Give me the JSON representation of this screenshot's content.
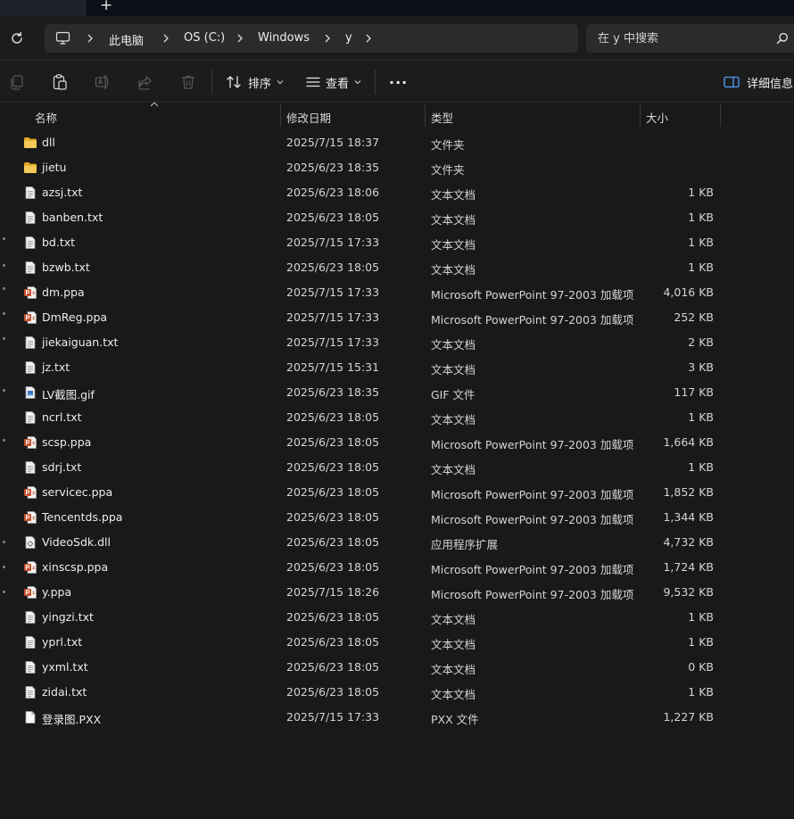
{
  "tabs": {
    "new_tab_label": "+"
  },
  "breadcrumb": [
    {
      "label": "此电脑"
    },
    {
      "label": "OS (C:)"
    },
    {
      "label": "Windows"
    },
    {
      "label": "y"
    }
  ],
  "search": {
    "placeholder": "在 y 中搜索"
  },
  "toolbar": {
    "sort_label": "排序",
    "view_label": "查看",
    "more_label": "···",
    "details_label": "详细信息"
  },
  "columns": {
    "name": "名称",
    "date": "修改日期",
    "type": "类型",
    "size": "大小"
  },
  "colors": {
    "folder": "#f2c14e",
    "ppa": "#c8502e",
    "accent": "#4ea1ff"
  },
  "files": [
    {
      "name": "dll",
      "date": "2025/7/15 18:37",
      "type": "文件夹",
      "size": "",
      "icon": "folder-icon"
    },
    {
      "name": "jietu",
      "date": "2025/6/23 18:35",
      "type": "文件夹",
      "size": "",
      "icon": "folder-icon"
    },
    {
      "name": "azsj.txt",
      "date": "2025/6/23 18:06",
      "type": "文本文档",
      "size": "1 KB",
      "icon": "text-file-icon"
    },
    {
      "name": "banben.txt",
      "date": "2025/6/23 18:05",
      "type": "文本文档",
      "size": "1 KB",
      "icon": "text-file-icon"
    },
    {
      "name": "bd.txt",
      "date": "2025/7/15 17:33",
      "type": "文本文档",
      "size": "1 KB",
      "icon": "text-file-icon"
    },
    {
      "name": "bzwb.txt",
      "date": "2025/6/23 18:05",
      "type": "文本文档",
      "size": "1 KB",
      "icon": "text-file-icon"
    },
    {
      "name": "dm.ppa",
      "date": "2025/7/15 17:33",
      "type": "Microsoft PowerPoint 97-2003 加载项",
      "size": "4,016 KB",
      "icon": "powerpoint-addin-icon"
    },
    {
      "name": "DmReg.ppa",
      "date": "2025/7/15 17:33",
      "type": "Microsoft PowerPoint 97-2003 加载项",
      "size": "252 KB",
      "icon": "powerpoint-addin-icon"
    },
    {
      "name": "jiekaiguan.txt",
      "date": "2025/7/15 17:33",
      "type": "文本文档",
      "size": "2 KB",
      "icon": "text-file-icon"
    },
    {
      "name": "jz.txt",
      "date": "2025/7/15 15:31",
      "type": "文本文档",
      "size": "3 KB",
      "icon": "text-file-icon"
    },
    {
      "name": "LV截图.gif",
      "date": "2025/6/23 18:35",
      "type": "GIF 文件",
      "size": "117 KB",
      "icon": "image-file-icon"
    },
    {
      "name": "ncrl.txt",
      "date": "2025/6/23 18:05",
      "type": "文本文档",
      "size": "1 KB",
      "icon": "text-file-icon"
    },
    {
      "name": "scsp.ppa",
      "date": "2025/6/23 18:05",
      "type": "Microsoft PowerPoint 97-2003 加载项",
      "size": "1,664 KB",
      "icon": "powerpoint-addin-icon"
    },
    {
      "name": "sdrj.txt",
      "date": "2025/6/23 18:05",
      "type": "文本文档",
      "size": "1 KB",
      "icon": "text-file-icon"
    },
    {
      "name": "servicec.ppa",
      "date": "2025/6/23 18:05",
      "type": "Microsoft PowerPoint 97-2003 加载项",
      "size": "1,852 KB",
      "icon": "powerpoint-addin-icon"
    },
    {
      "name": "Tencentds.ppa",
      "date": "2025/6/23 18:05",
      "type": "Microsoft PowerPoint 97-2003 加载项",
      "size": "1,344 KB",
      "icon": "powerpoint-addin-icon"
    },
    {
      "name": "VideoSdk.dll",
      "date": "2025/6/23 18:05",
      "type": "应用程序扩展",
      "size": "4,732 KB",
      "icon": "dll-file-icon"
    },
    {
      "name": "xinscsp.ppa",
      "date": "2025/6/23 18:05",
      "type": "Microsoft PowerPoint 97-2003 加载项",
      "size": "1,724 KB",
      "icon": "powerpoint-addin-icon"
    },
    {
      "name": "y.ppa",
      "date": "2025/7/15 18:26",
      "type": "Microsoft PowerPoint 97-2003 加载项",
      "size": "9,532 KB",
      "icon": "powerpoint-addin-icon"
    },
    {
      "name": "yingzi.txt",
      "date": "2025/6/23 18:05",
      "type": "文本文档",
      "size": "1 KB",
      "icon": "text-file-icon"
    },
    {
      "name": "yprl.txt",
      "date": "2025/6/23 18:05",
      "type": "文本文档",
      "size": "1 KB",
      "icon": "text-file-icon"
    },
    {
      "name": "yxml.txt",
      "date": "2025/6/23 18:05",
      "type": "文本文档",
      "size": "0 KB",
      "icon": "text-file-icon"
    },
    {
      "name": "zidai.txt",
      "date": "2025/6/23 18:05",
      "type": "文本文档",
      "size": "1 KB",
      "icon": "text-file-icon"
    },
    {
      "name": "登录图.PXX",
      "date": "2025/7/15 17:33",
      "type": "PXX 文件",
      "size": "1,227 KB",
      "icon": "blank-file-icon"
    }
  ]
}
